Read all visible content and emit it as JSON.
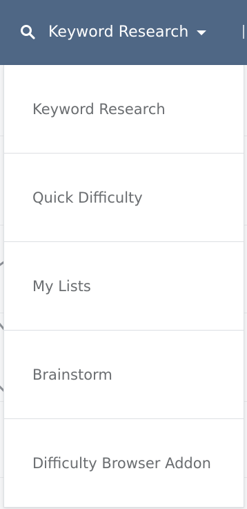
{
  "nav": {
    "active_label": "Keyword Research",
    "icon": "search-icon",
    "bar_color": "#4f6785"
  },
  "dropdown": {
    "items": [
      {
        "label": "Keyword Research"
      },
      {
        "label": "Quick Difficulty"
      },
      {
        "label": "My Lists"
      },
      {
        "label": "Brainstorm"
      },
      {
        "label": "Difficulty Browser Addon"
      }
    ]
  }
}
